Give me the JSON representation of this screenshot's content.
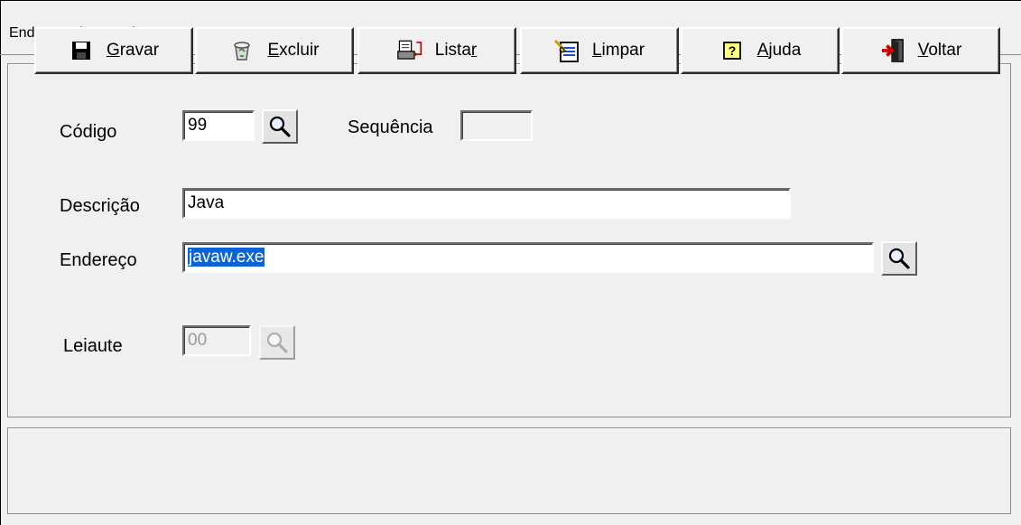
{
  "window": {
    "title": "Endereço dos Arquivos"
  },
  "form": {
    "codigo": {
      "label": "Código",
      "value": "99"
    },
    "sequencia": {
      "label": "Sequência",
      "value": ""
    },
    "descricao": {
      "label": "Descrição",
      "value": "Java"
    },
    "endereco": {
      "label": "Endereço",
      "value": "javaw.exe"
    },
    "leiaute": {
      "label": "Leiaute",
      "value": "00"
    }
  },
  "toolbar": {
    "buttons": [
      {
        "label": "Gravar",
        "accel": "G",
        "rest": "ravar",
        "icon": "floppy-disk-icon"
      },
      {
        "label": "Excluir",
        "accel": "E",
        "rest": "xcluir",
        "icon": "recycle-bin-icon"
      },
      {
        "label": "Listar",
        "pre": "Lista",
        "accel": "r",
        "icon": "printer-icon"
      },
      {
        "label": "Limpar",
        "accel": "L",
        "rest": "impar",
        "icon": "clear-form-icon"
      },
      {
        "label": "Ajuda",
        "accel": "A",
        "rest": "juda",
        "icon": "help-icon"
      },
      {
        "label": "Voltar",
        "accel": "V",
        "rest": "oltar",
        "icon": "exit-door-icon"
      }
    ]
  }
}
